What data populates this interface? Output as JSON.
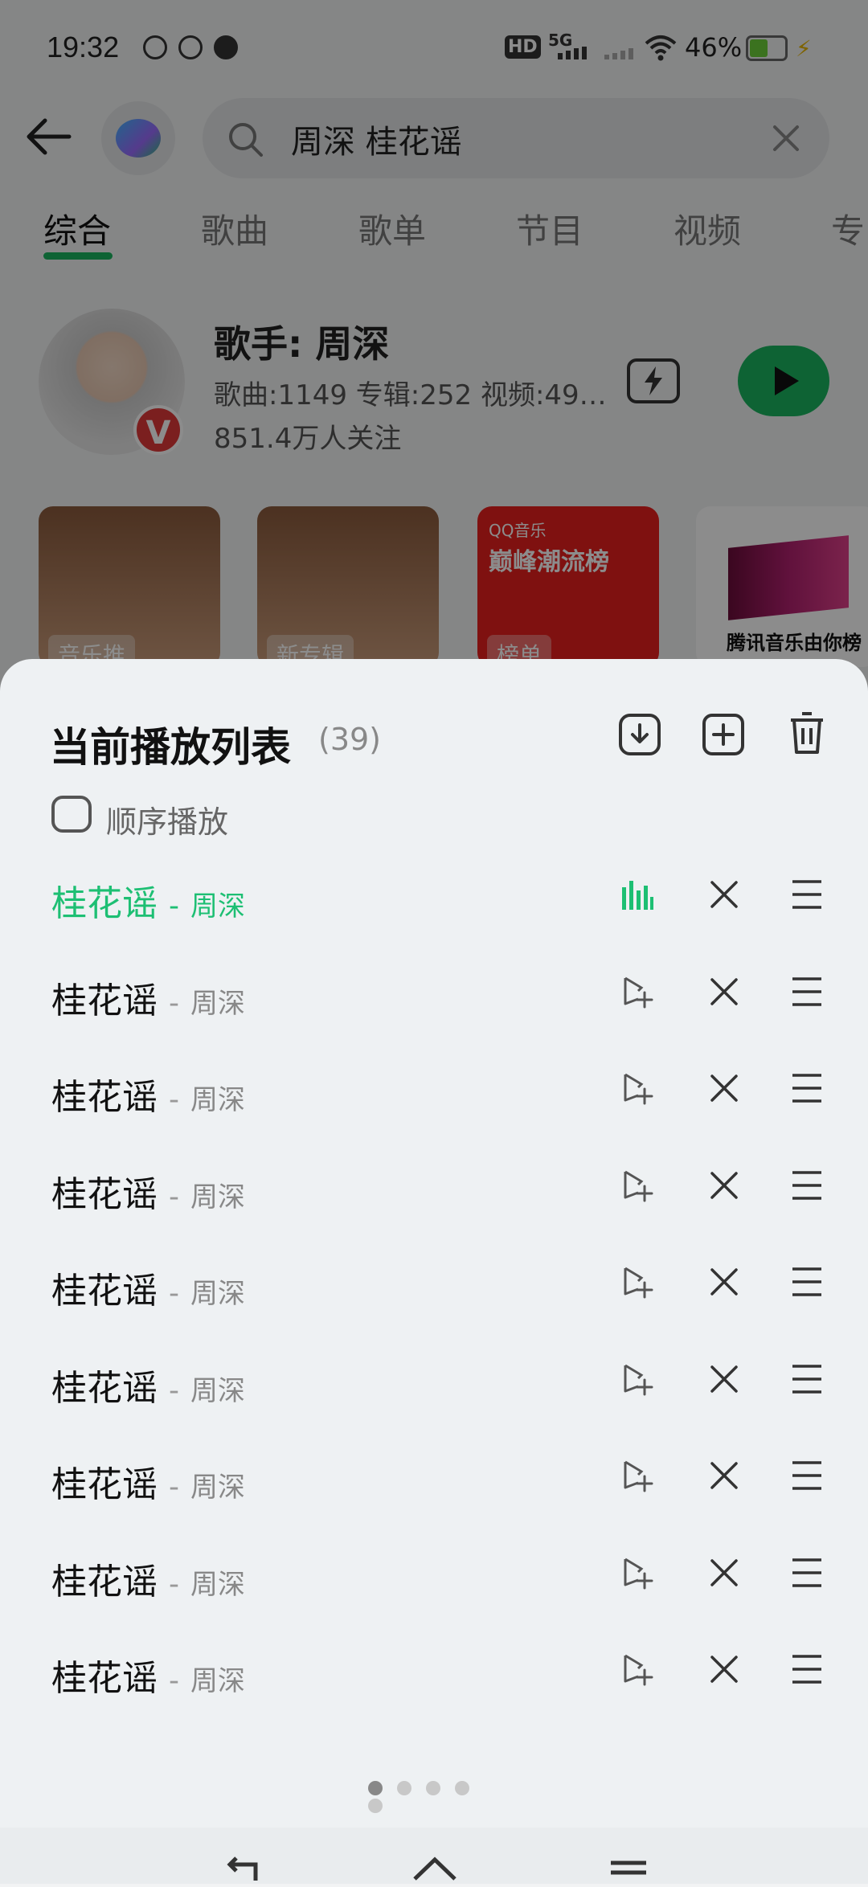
{
  "status_bar": {
    "time": "19:32",
    "network": "5G",
    "battery_percent": "46%",
    "hd": "HD"
  },
  "search": {
    "query": "周深 桂花谣"
  },
  "tabs": [
    {
      "label": "综合",
      "active": true
    },
    {
      "label": "歌曲"
    },
    {
      "label": "歌单"
    },
    {
      "label": "节目"
    },
    {
      "label": "视频"
    },
    {
      "label": "专"
    }
  ],
  "artist": {
    "title": "歌手: 周深",
    "stats": "歌曲:1149 专辑:252 视频:49…",
    "followers": "851.4万人关注",
    "badge": "V"
  },
  "cards": [
    {
      "label": "音乐推"
    },
    {
      "label": "新专辑"
    },
    {
      "label": "榜单",
      "title": "巅峰潮流榜",
      "brand": "QQ音乐"
    },
    {
      "title": "腾讯音乐由你榜"
    }
  ],
  "playlist": {
    "title": "当前播放列表",
    "count": "(39)",
    "mode_label": "顺序播放",
    "separator": "-",
    "songs": [
      {
        "title": "桂花谣",
        "artist": "周深",
        "playing": true
      },
      {
        "title": "桂花谣",
        "artist": "周深"
      },
      {
        "title": "桂花谣",
        "artist": "周深"
      },
      {
        "title": "桂花谣",
        "artist": "周深"
      },
      {
        "title": "桂花谣",
        "artist": "周深"
      },
      {
        "title": "桂花谣",
        "artist": "周深"
      },
      {
        "title": "桂花谣",
        "artist": "周深"
      },
      {
        "title": "桂花谣",
        "artist": "周深"
      },
      {
        "title": "桂花谣",
        "artist": "周深"
      }
    ],
    "page_dots": 5,
    "active_dot": 0
  },
  "colors": {
    "accent": "#1dbf73",
    "sheet_bg": "#eef1f3"
  }
}
